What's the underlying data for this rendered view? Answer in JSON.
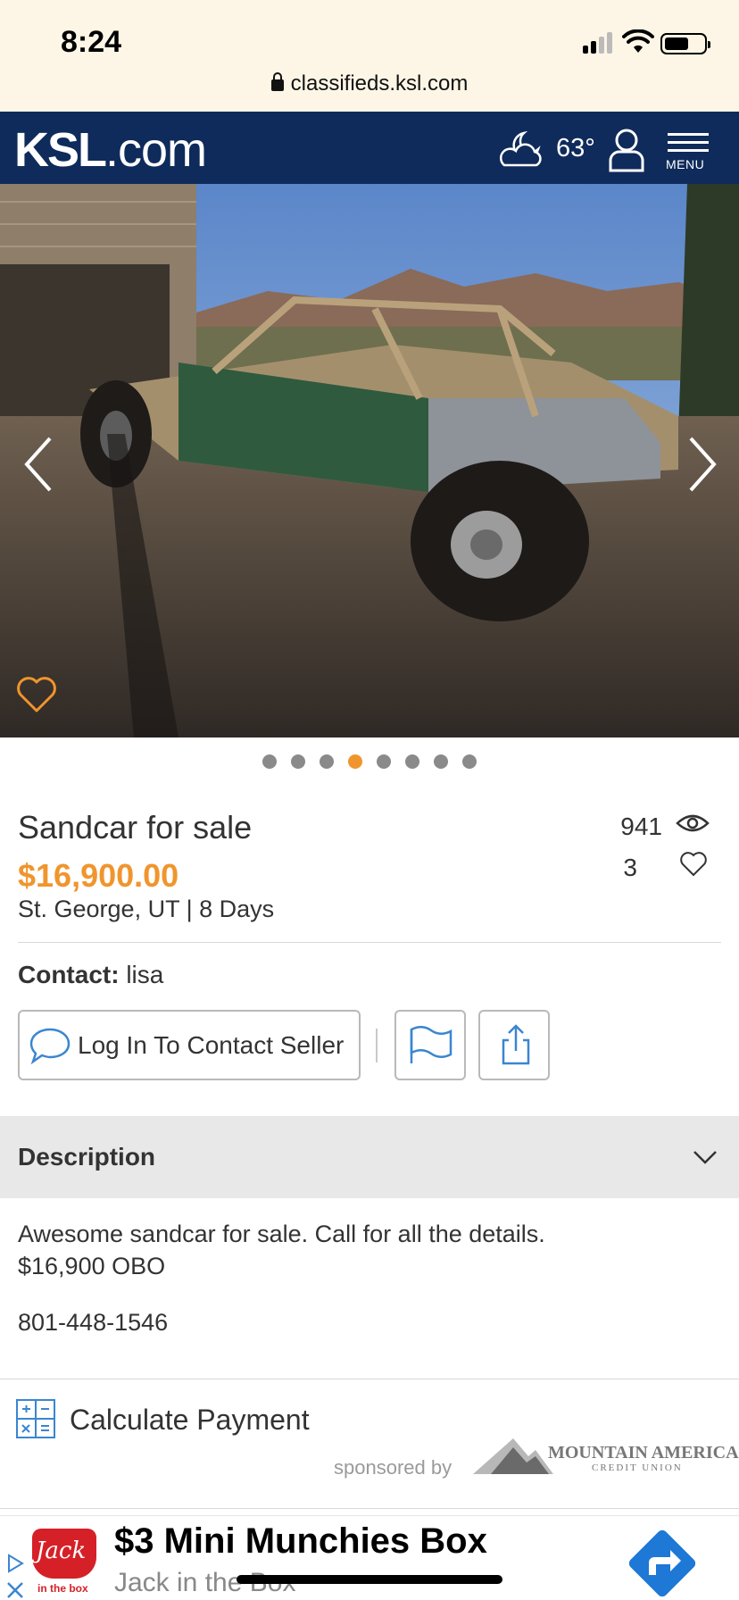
{
  "status_bar": {
    "time": "8:24",
    "url": "classifieds.ksl.com"
  },
  "header": {
    "logo_main": "KSL",
    "logo_suffix": ".com",
    "temperature": "63°",
    "menu_label": "MENU",
    "icons": [
      "partly-cloudy-night-icon",
      "user-icon",
      "menu-icon"
    ]
  },
  "gallery": {
    "image_description_icon": "photo",
    "total_images": 8,
    "active_index": 3,
    "prev_icon": "chevron-left-icon",
    "next_icon": "chevron-right-icon",
    "favorite_icon": "heart-outline-icon"
  },
  "listing": {
    "title": "Sandcar for sale",
    "price": "$16,900.00",
    "location_age": "St. George, UT | 8 Days",
    "views": "941",
    "favorites": "3"
  },
  "contact": {
    "label": "Contact:",
    "name": "lisa",
    "contact_button": "Log In To Contact Seller",
    "flag_icon": "flag-icon",
    "share_icon": "share-icon"
  },
  "description": {
    "heading": "Description",
    "line1": "Awesome sandcar for sale. Call for all the details.",
    "line2": "$16,900 OBO",
    "phone": "801-448-1546"
  },
  "payment": {
    "label": "Calculate Payment",
    "sponsored_by": "sponsored by",
    "sponsor_name": "MOUNTAIN AMERICA",
    "sponsor_sub": "CREDIT UNION"
  },
  "ad": {
    "title": "$3 Mini Munchies Box",
    "advertiser": "Jack in the Box",
    "logo_text": "Jack",
    "logo_sub": "in the box"
  },
  "colors": {
    "header_bg": "#0f2b5b",
    "price": "#f0952d",
    "active_dot": "#f0952d",
    "accent_icon": "#3a86d0"
  }
}
